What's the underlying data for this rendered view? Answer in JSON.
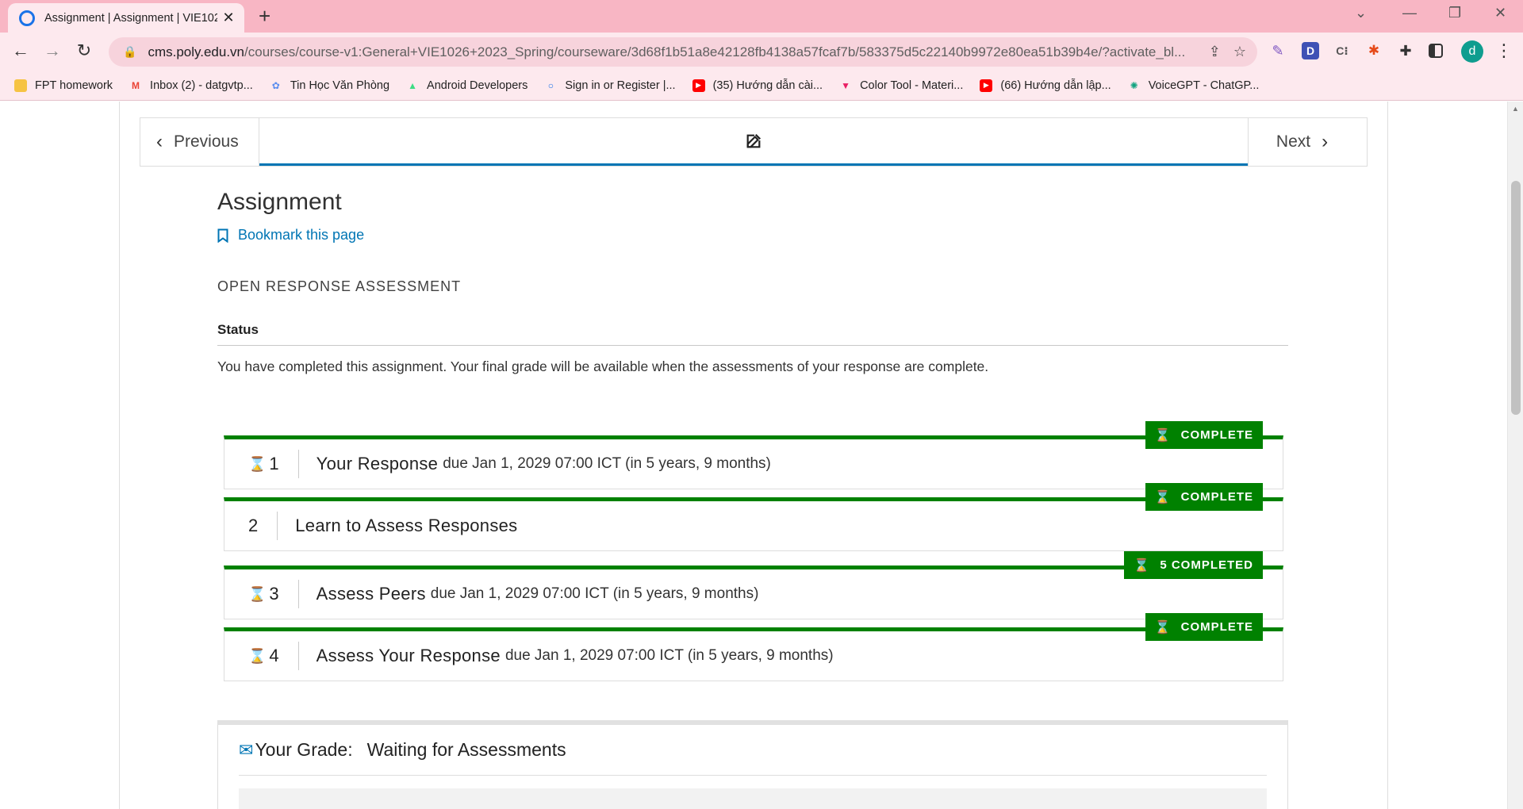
{
  "browser": {
    "tab_title": "Assignment | Assignment | VIE1026",
    "url_host": "cms.poly.edu.vn",
    "url_path": "/courses/course-v1:General+VIE1026+2023_Spring/courseware/3d68f1b51a8e42128fb4138a57fcaf7b/583375d5c22140b9972e80ea51b39b4e/?activate_bl...",
    "profile_initial": "d",
    "bookmarks": [
      {
        "label": "FPT homework",
        "icon": "folder-icon",
        "color": "#f6c343"
      },
      {
        "label": "Inbox (2) - datgvtp...",
        "icon": "gmail-icon",
        "color": "#ea4335"
      },
      {
        "label": "Tin Học Văn Phòng",
        "icon": "site-icon",
        "color": "#5b8def"
      },
      {
        "label": "Android Developers",
        "icon": "android-icon",
        "color": "#3ddc84"
      },
      {
        "label": "Sign in or Register |...",
        "icon": "circle-icon",
        "color": "#1a73e8"
      },
      {
        "label": "(35) Hướng dẫn cài...",
        "icon": "youtube-icon",
        "color": "#ff0000"
      },
      {
        "label": "Color Tool - Materi...",
        "icon": "material-icon",
        "color": "#e91e63"
      },
      {
        "label": "(66) Hướng dẫn lập...",
        "icon": "youtube-icon",
        "color": "#ff0000"
      },
      {
        "label": "VoiceGPT - ChatGP...",
        "icon": "chatgpt-icon",
        "color": "#10a37f"
      }
    ]
  },
  "seqnav": {
    "prev_label": "Previous",
    "next_label": "Next"
  },
  "unit": {
    "title": "Assignment",
    "bookmark_label": "Bookmark this page"
  },
  "ora": {
    "title": "OPEN RESPONSE ASSESSMENT",
    "status_label": "Status",
    "status_message": "You have completed this assignment. Your final grade will be available when the assessments of your response are complete.",
    "steps": [
      {
        "number": "1",
        "title": "Your Response",
        "due": "due Jan 1, 2029 07:00 ICT (in 5 years, 9 months)",
        "badge": "COMPLETE"
      },
      {
        "number": "2",
        "title": "Learn to Assess Responses",
        "due": "",
        "badge": "COMPLETE"
      },
      {
        "number": "3",
        "title": "Assess Peers",
        "due": "due Jan 1, 2029 07:00 ICT (in 5 years, 9 months)",
        "badge": "5 COMPLETED"
      },
      {
        "number": "4",
        "title": "Assess Your Response",
        "due": "due Jan 1, 2029 07:00 ICT (in 5 years, 9 months)",
        "badge": "COMPLETE"
      }
    ],
    "grade_label": "Your Grade:",
    "grade_value": "Waiting for Assessments"
  },
  "colors": {
    "accent": "#0075b4",
    "complete": "#008100",
    "tab_strip": "#f8b6c4"
  }
}
